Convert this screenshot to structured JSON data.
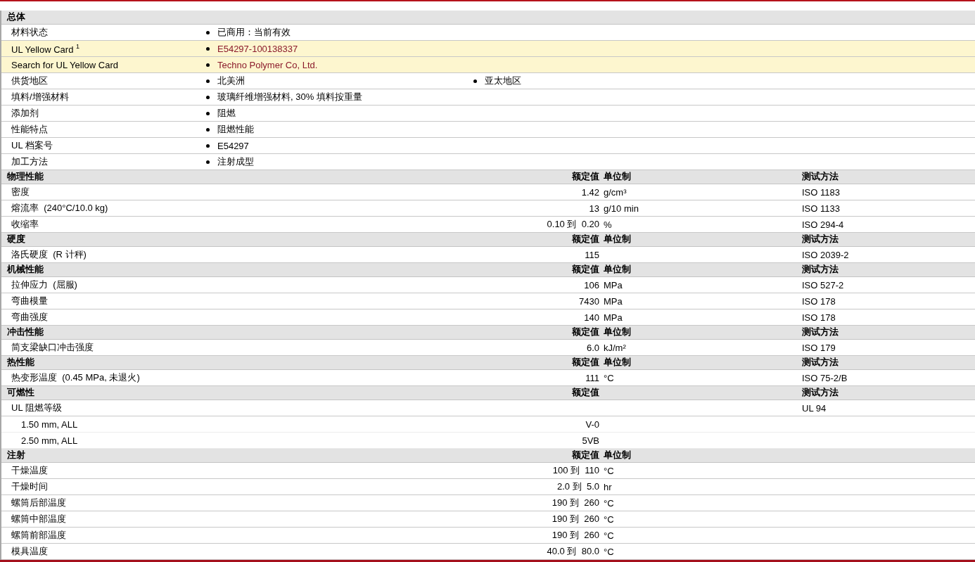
{
  "general": {
    "title": "总体",
    "rows": [
      {
        "label": "材料状态",
        "highlighted": false,
        "link": false,
        "values": [
          "已商用：当前有效"
        ]
      },
      {
        "label": "UL Yellow Card $^{1}$",
        "highlighted": true,
        "link": true,
        "values": [
          "E54297-100138337"
        ]
      },
      {
        "label": "Search for UL Yellow Card",
        "highlighted": true,
        "link": true,
        "values": [
          "Techno Polymer Co, Ltd."
        ]
      },
      {
        "label": "供货地区",
        "highlighted": false,
        "link": false,
        "values": [
          "北美洲",
          "亚太地区"
        ]
      },
      {
        "label": "填料/增强材料",
        "highlighted": false,
        "link": false,
        "values": [
          "玻璃纤维增强材料, 30% 填料按重量"
        ]
      },
      {
        "label": "添加剂",
        "highlighted": false,
        "link": false,
        "values": [
          "阻燃"
        ]
      },
      {
        "label": "性能特点",
        "highlighted": false,
        "link": false,
        "values": [
          "阻燃性能"
        ]
      },
      {
        "label": "UL 档案号",
        "highlighted": false,
        "link": false,
        "values": [
          "E54297"
        ]
      },
      {
        "label": "加工方法",
        "highlighted": false,
        "link": false,
        "values": [
          "注射成型"
        ]
      }
    ]
  },
  "sections": [
    {
      "title": "物理性能",
      "headers": {
        "value": "额定值",
        "unit": "单位制",
        "method": "测试方法"
      },
      "rows": [
        {
          "label": "密度",
          "value": "1.42",
          "unit": "g/cm³",
          "method": "ISO 1183"
        },
        {
          "label": "熔流率  (240°C/10.0 kg)",
          "value": "13",
          "unit": "g/10 min",
          "method": "ISO 1133"
        },
        {
          "label": "收缩率",
          "value": "0.10 到  0.20",
          "unit": "%",
          "method": "ISO 294-4"
        }
      ]
    },
    {
      "title": "硬度",
      "headers": {
        "value": "额定值",
        "unit": "单位制",
        "method": "测试方法"
      },
      "rows": [
        {
          "label": "洛氏硬度  (R 计秤)",
          "value": "115",
          "method": "ISO 2039-2"
        }
      ]
    },
    {
      "title": "机械性能",
      "headers": {
        "value": "额定值",
        "unit": "单位制",
        "method": "测试方法"
      },
      "rows": [
        {
          "label": "拉伸应力  (屈服)",
          "value": "106",
          "unit": "MPa",
          "method": "ISO 527-2"
        },
        {
          "label": "弯曲模量",
          "value": "7430",
          "unit": "MPa",
          "method": "ISO 178"
        },
        {
          "label": "弯曲强度",
          "value": "140",
          "unit": "MPa",
          "method": "ISO 178"
        }
      ]
    },
    {
      "title": "冲击性能",
      "headers": {
        "value": "额定值",
        "unit": "单位制",
        "method": "测试方法"
      },
      "rows": [
        {
          "label": "简支梁缺口冲击强度",
          "value": "6.0",
          "unit": "kJ/m²",
          "method": "ISO 179"
        }
      ]
    },
    {
      "title": "热性能",
      "headers": {
        "value": "额定值",
        "unit": "单位制",
        "method": "测试方法"
      },
      "rows": [
        {
          "label": "热变形温度  (0.45 MPa, 未退火)",
          "value": "111",
          "unit": "°C",
          "method": "ISO 75-2/B"
        }
      ]
    },
    {
      "title": "可燃性",
      "headers": {
        "value": "额定值",
        "method": "测试方法"
      },
      "rows": [
        {
          "label": "UL 阻燃等级",
          "method": "UL 94",
          "children": [
            {
              "label": "1.50 mm, ALL",
              "value": "V-0"
            },
            {
              "label": "2.50 mm, ALL",
              "value": "5VB"
            }
          ]
        }
      ]
    },
    {
      "title": "注射",
      "headers": {
        "value": "额定值",
        "unit": "单位制"
      },
      "rows": [
        {
          "label": "干燥温度",
          "value": "100 到  110",
          "unit": "°C"
        },
        {
          "label": "干燥时间",
          "value": "2.0 到  5.0",
          "unit": "hr"
        },
        {
          "label": "螺筒后部温度",
          "value": "190 到  260",
          "unit": "°C"
        },
        {
          "label": "螺筒中部温度",
          "value": "190 到  260",
          "unit": "°C"
        },
        {
          "label": "螺筒前部温度",
          "value": "190 到  260",
          "unit": "°C"
        },
        {
          "label": "模具温度",
          "value": "40.0 到  80.0",
          "unit": "°C"
        }
      ]
    }
  ]
}
